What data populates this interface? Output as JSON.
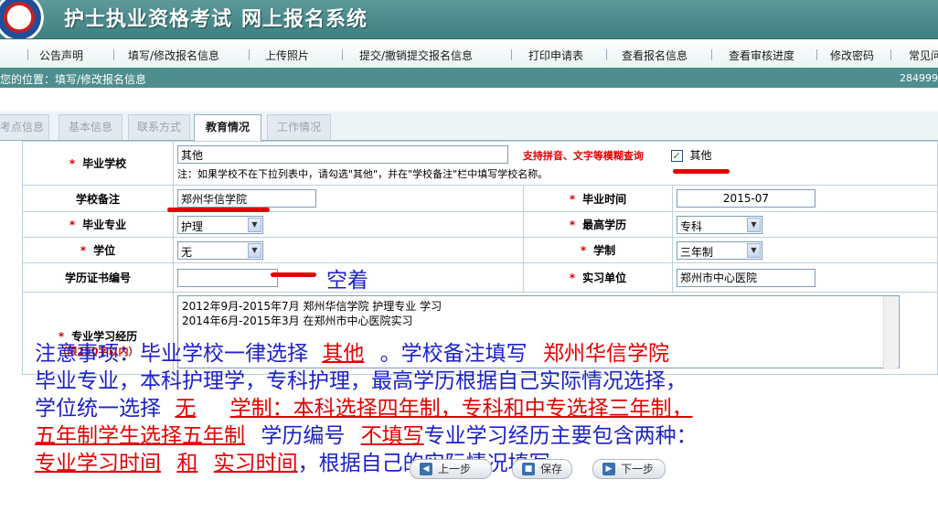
{
  "header": {
    "title": "护士执业资格考试",
    "subtitle": "网上报名系统"
  },
  "nav": {
    "items": [
      "公告声明",
      "填写/修改报名信息",
      "上传照片",
      "提交/撤销提交报名信息",
      "打印申请表",
      "查看报名信息",
      "查看审核进度",
      "修改密码",
      "常见问"
    ]
  },
  "location": {
    "text": "您的位置：填写/修改报名信息",
    "number": "284999"
  },
  "tabs": [
    {
      "label": "考点信息",
      "active": false
    },
    {
      "label": "基本信息",
      "active": false
    },
    {
      "label": "联系方式",
      "active": false
    },
    {
      "label": "教育情况",
      "active": true
    },
    {
      "label": "工作情况",
      "active": false
    }
  ],
  "form": {
    "school_label": "毕业学校",
    "school_value": "其他",
    "school_hint": "支持拼音、文字等模糊查询",
    "school_other_label": "其他",
    "school_note": "注：如果学校不在下拉列表中，请勾选\"其他\"，并在\"学校备注\"栏中填写学校名称。",
    "remark_label": "学校备注",
    "remark_value": "郑州华信学院",
    "grad_time_label": "毕业时间",
    "grad_time_value": "2015-07",
    "major_label": "毕业专业",
    "major_value": "护理",
    "edu_label": "最高学历",
    "edu_value": "专科",
    "degree_label": "学位",
    "degree_value": "无",
    "system_label": "学制",
    "system_value": "三年制",
    "cert_label": "学历证书编号",
    "cert_value": "",
    "intern_label": "实习单位",
    "intern_value": "郑州市中心医院",
    "study_label": "专业学习经历",
    "study_limit": "（限250字以内）",
    "study_value": "2012年9月-2015年7月 郑州华信学院 护理专业 学习\n2014年6月-2015年3月 在郑州市中心医院实习"
  },
  "annotation": {
    "empty_note": "空着",
    "l1_a": "注意事项：毕业学校一律选择",
    "l1_b": "其他",
    "l1_c": "。学校备注填写",
    "l1_d": "郑州华信学院",
    "l2": "毕业专业，本科护理学，专科护理，最高学历根据自己实际情况选择，",
    "l3_a": "学位统一选择",
    "l3_b": "无",
    "l3_c": "学制：本科选择四年制，专科和中专选择三年制，",
    "l4_a": "五年制学生选择五年制",
    "l4_b": "学历编号",
    "l4_c": "不填写",
    "l4_d": "专业学习经历主要包含两种：",
    "l5_a": "专业学习时间",
    "l5_b": "和",
    "l5_c": "实习时间",
    "l5_d": "，根据自己的实际情况填写。"
  },
  "buttons": {
    "prev": "上一步",
    "save": "保存",
    "next": "下一步"
  },
  "colors": {
    "header": "#4f8e8e",
    "annotation_blue": "#1d22c8",
    "annotation_red": "#e40000",
    "required": "#d40000"
  }
}
